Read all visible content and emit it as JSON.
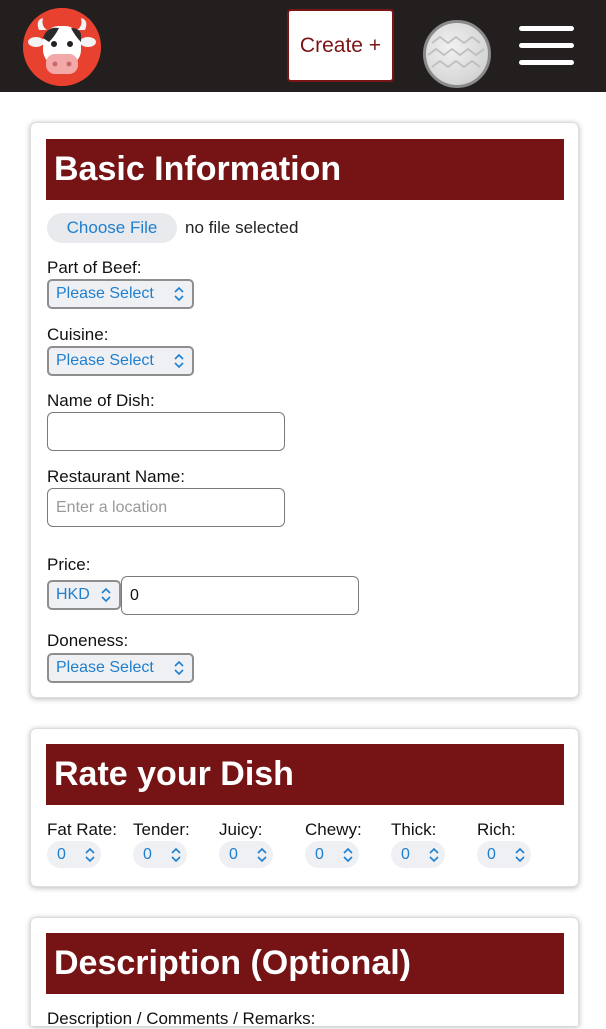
{
  "header": {
    "create_label": "Create +"
  },
  "basic": {
    "title": "Basic Information",
    "file_button": "Choose File",
    "file_status": "no file selected",
    "part_label": "Part of Beef:",
    "part_value": "Please Select",
    "cuisine_label": "Cuisine:",
    "cuisine_value": "Please Select",
    "dish_label": "Name of Dish:",
    "dish_value": "",
    "restaurant_label": "Restaurant Name:",
    "restaurant_placeholder": "Enter a location",
    "price_label": "Price:",
    "currency": "HKD",
    "price_value": "0",
    "doneness_label": "Doneness:",
    "doneness_value": "Please Select"
  },
  "rate": {
    "title": "Rate your Dish",
    "items": [
      {
        "label": "Fat Rate:",
        "value": "0"
      },
      {
        "label": "Tender:",
        "value": "0"
      },
      {
        "label": "Juicy:",
        "value": "0"
      },
      {
        "label": "Chewy:",
        "value": "0"
      },
      {
        "label": "Thick:",
        "value": "0"
      },
      {
        "label": "Rich:",
        "value": "0"
      }
    ]
  },
  "description": {
    "title": "Description (Optional)",
    "comments_label": "Description / Comments / Remarks:"
  },
  "colors": {
    "header_bg": "#231f1f",
    "accent": "#761415",
    "select_text": "#1f7fcf"
  }
}
